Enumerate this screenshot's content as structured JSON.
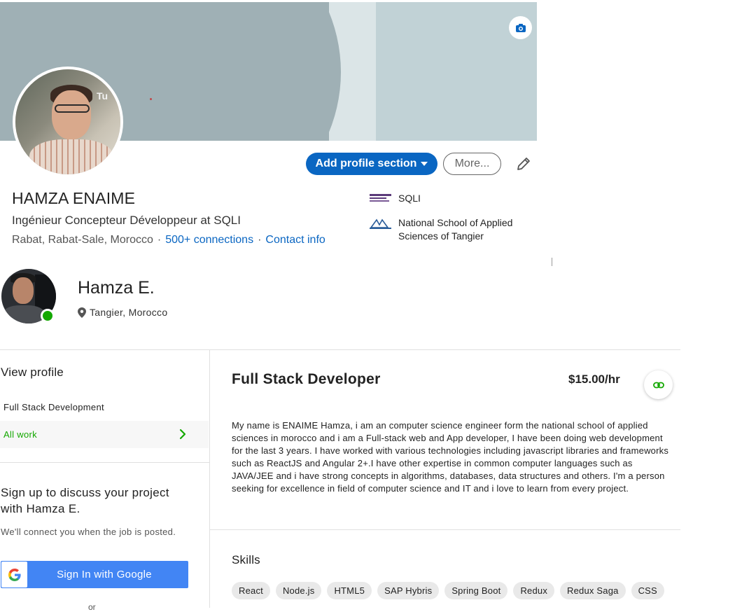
{
  "linkedin": {
    "name": "HAMZA ENAIME",
    "headline": "Ingénieur Concepteur Développeur at SQLI",
    "location": "Rabat, Rabat-Sale, Morocco",
    "connections": "500+ connections",
    "contact": "Contact info",
    "separator": "·",
    "add_section_label": "Add profile section",
    "more_label": "More...",
    "avatar_sign": "Tu",
    "organizations": [
      {
        "name": "SQLI"
      },
      {
        "name": "National School of Applied Sciences of Tangier"
      }
    ]
  },
  "upwork": {
    "name": "Hamza E.",
    "location": "Tangier, Morocco",
    "sidebar": {
      "title": "View profile",
      "item": "Full Stack Development",
      "all_work": "All work",
      "signup_title": "Sign up to discuss your project with Hamza E.",
      "signup_sub": "We'll connect you when the job is posted.",
      "google_button": "Sign In with Google",
      "cut_text": "or"
    },
    "job": {
      "title": "Full Stack Developer",
      "rate": "$15.00/hr",
      "overview": "My name is ENAIME Hamza, i am an computer science engineer form the national school of applied sciences in morocco and i am a Full-stack web and App developer, I have been doing web development for the last 3 years. I have worked with various technologies including javascript libraries and frameworks such as ReactJS and Angular 2+.I have other expertise in common computer languages such as JAVA/JEE and i have strong concepts in algorithms, databases, data structures and others. I'm a person seeking for excellence in field of computer science and IT and i love to learn from every project."
    },
    "skills_title": "Skills",
    "skills": [
      "React",
      "Node.js",
      "HTML5",
      "SAP Hybris",
      "Spring Boot",
      "Redux",
      "Redux Saga",
      "CSS"
    ]
  },
  "colors": {
    "linkedin_blue": "#0a66c2",
    "upwork_green": "#14a800",
    "google_blue": "#4285f4"
  },
  "icons": [
    "camera-icon",
    "caret-down-icon",
    "pencil-icon",
    "location-pin-icon",
    "chevron-right-icon",
    "google-icon",
    "link-icon"
  ]
}
